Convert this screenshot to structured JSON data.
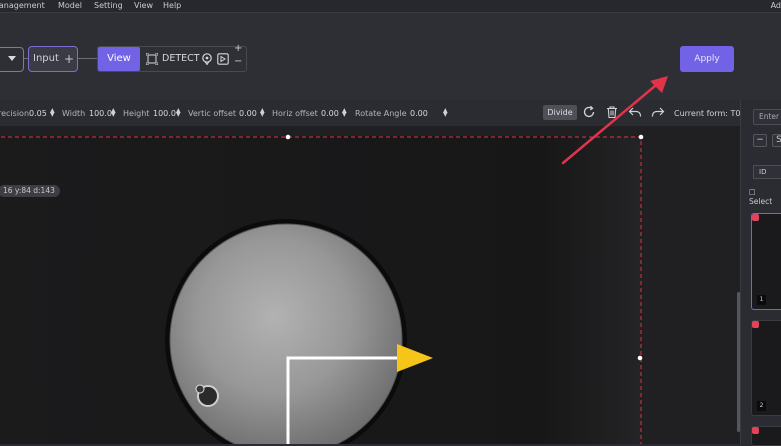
{
  "menubar": {
    "items": [
      "Management",
      "Model",
      "Setting",
      "View",
      "Help"
    ],
    "right_text": "Ad"
  },
  "toolbar": {
    "input_label": "Input",
    "view_label": "View",
    "detect_label": "DETECT",
    "apply_label": "Apply"
  },
  "params": {
    "precision_label": "recision",
    "precision_value": "0.05",
    "width_label": "Width",
    "width_value": "100.0",
    "height_label": "Height",
    "height_value": "100.0",
    "vertical_offset_label": "Vertic offset",
    "vertical_offset_value": "0.00",
    "horizontal_offset_label": "Horiz offset",
    "horizontal_offset_value": "0.00",
    "rotate_angle_label": "Rotate Angle",
    "rotate_angle_value": "0.00",
    "divide_label": "Divide",
    "current_form": "Current form: T0"
  },
  "canvas": {
    "coord_tag": "16 y:84 d:143"
  },
  "right_panel": {
    "search_placeholder": "Enter",
    "small_btn_minus": "−",
    "small_btn_s": "S",
    "select_value": "ID",
    "select_all_label": "Select",
    "thumbs": [
      {
        "num": "1"
      },
      {
        "num": "2"
      },
      {
        "num": ""
      }
    ]
  },
  "colors": {
    "accent": "#7262e5",
    "annotation_red": "#e0344b",
    "arrow_yellow": "#f5c51a",
    "background": "#2b2c31"
  }
}
